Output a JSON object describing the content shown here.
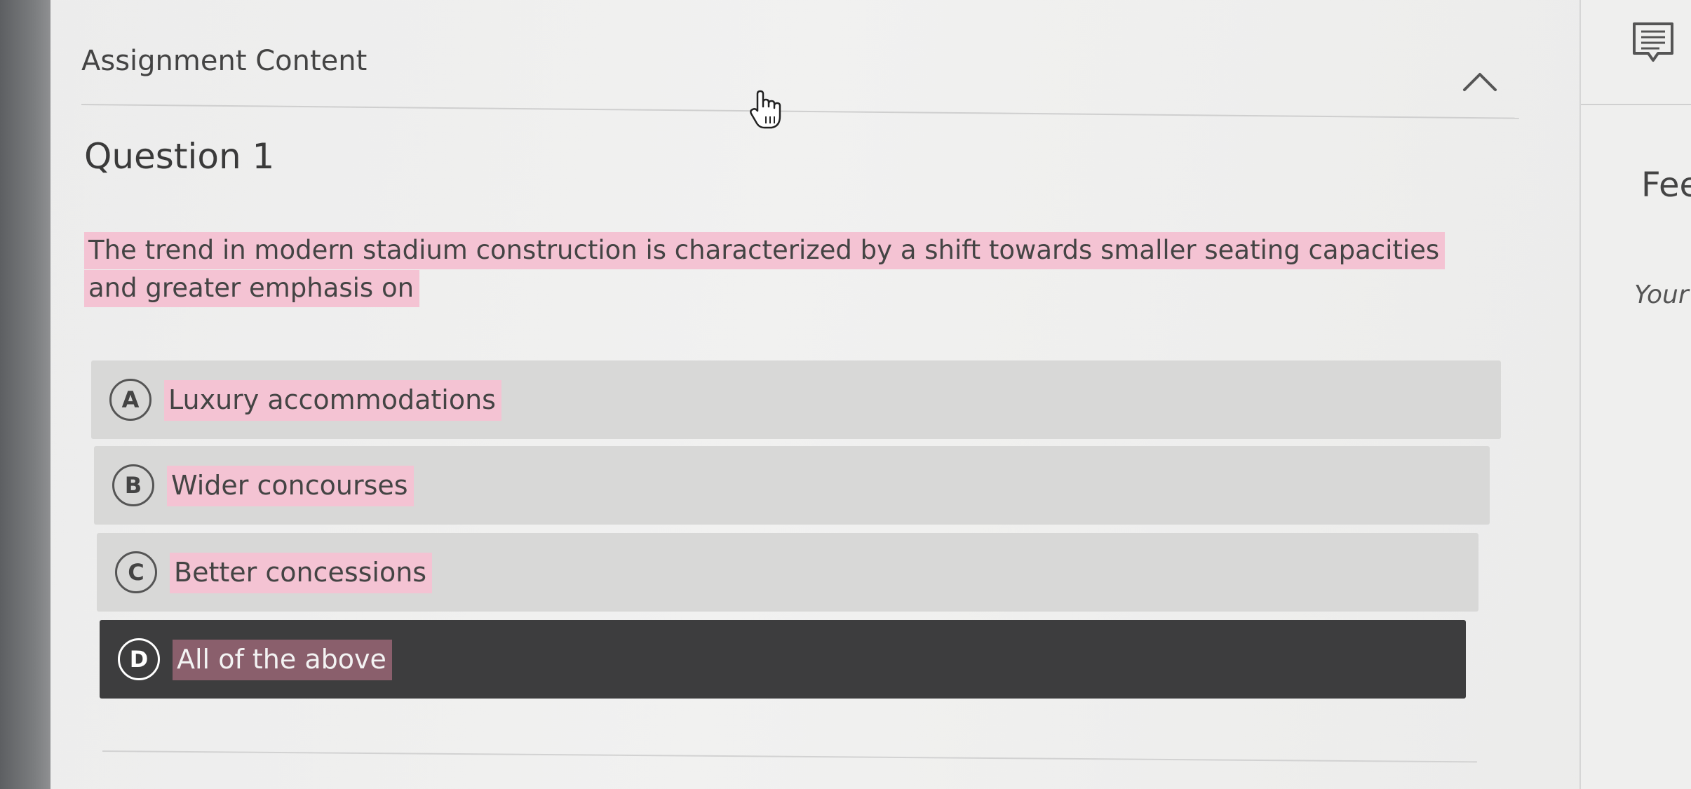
{
  "assignment": {
    "section_title": "Assignment Content",
    "collapse_icon": "chevron-up-icon"
  },
  "question": {
    "title": "Question 1",
    "text": "The trend in modern stadium construction is characterized by a shift towards smaller seating capacities and greater emphasis on",
    "options": [
      {
        "letter": "A",
        "text": "Luxury accommodations",
        "selected": false
      },
      {
        "letter": "B",
        "text": "Wider concourses",
        "selected": false
      },
      {
        "letter": "C",
        "text": "Better concessions",
        "selected": false
      },
      {
        "letter": "D",
        "text": "All of the above",
        "selected": true
      }
    ]
  },
  "side_panel": {
    "icon": "feedback-icon",
    "heading": "Fee",
    "subtext": "Your"
  },
  "colors": {
    "highlight": "#f4c3d3",
    "option_bg": "#d8d8d7",
    "selected_bg": "#3d3d3e"
  }
}
